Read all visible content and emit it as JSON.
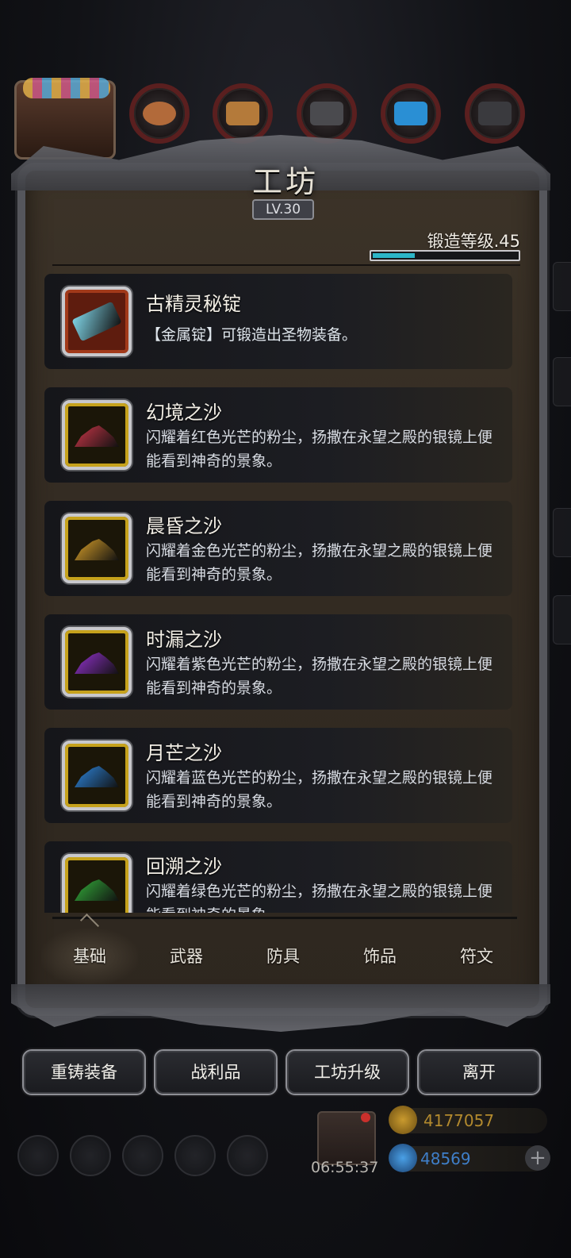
{
  "workshop": {
    "title": "工坊",
    "level": "LV.30",
    "forge_level_label": "锻造等级.45",
    "forge_progress": 0.29
  },
  "items": [
    {
      "name": "古精灵秘锭",
      "desc": "【金属锭】可锻造出圣物装备。",
      "icon": "metal-ingot-icon",
      "color": "#7fd4e6"
    },
    {
      "name": "幻境之沙",
      "desc": "闪耀着红色光芒的粉尘，扬撒在永望之殿的银镜上便能看到神奇的景象。",
      "icon": "red-sand-icon",
      "color": "#d2384a"
    },
    {
      "name": "晨昏之沙",
      "desc": "闪耀着金色光芒的粉尘，扬撒在永望之殿的银镜上便能看到神奇的景象。",
      "icon": "gold-sand-icon",
      "color": "#e0a52a"
    },
    {
      "name": "时漏之沙",
      "desc": "闪耀着紫色光芒的粉尘，扬撒在永望之殿的银镜上便能看到神奇的景象。",
      "icon": "purple-sand-icon",
      "color": "#9a34d8"
    },
    {
      "name": "月芒之沙",
      "desc": "闪耀着蓝色光芒的粉尘，扬撒在永望之殿的银镜上便能看到神奇的景象。",
      "icon": "blue-sand-icon",
      "color": "#2f8be6"
    },
    {
      "name": "回溯之沙",
      "desc": "闪耀着绿色光芒的粉尘，扬撒在永望之殿的银镜上便能看到神奇的景象。",
      "icon": "green-sand-icon",
      "color": "#35b43c"
    }
  ],
  "tabs": [
    "基础",
    "武器",
    "防具",
    "饰品",
    "符文"
  ],
  "active_tab": "基础",
  "buttons": {
    "recast": "重铸装备",
    "loot": "战利品",
    "upgrade": "工坊升级",
    "leave": "离开"
  },
  "hud": {
    "timer": "06:55:37",
    "gold": "4177057",
    "gems": "48569"
  },
  "colors": {
    "gold_text": "#b38a2e",
    "gem_text": "#3f7fc9",
    "progress_fill": "#2bb5c8"
  }
}
